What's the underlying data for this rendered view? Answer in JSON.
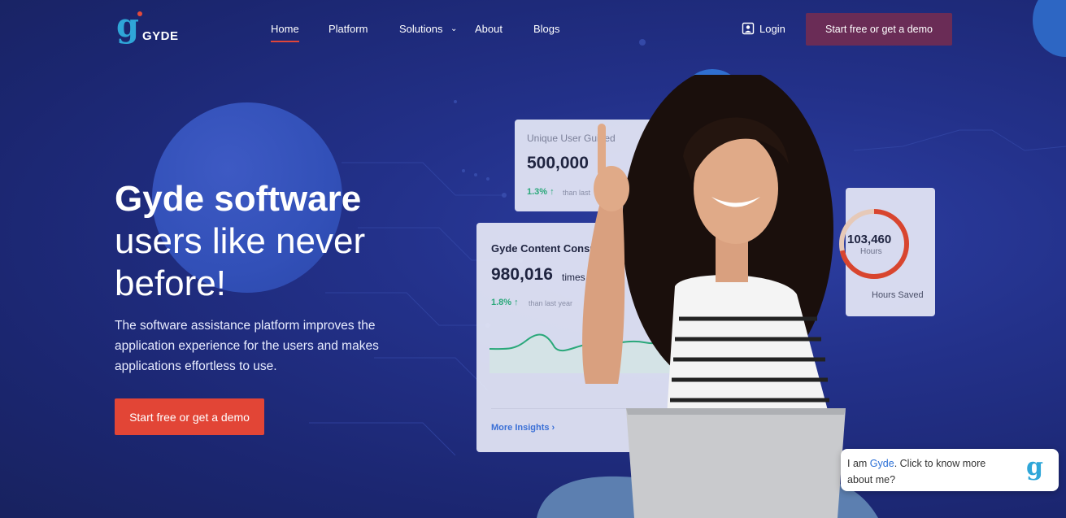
{
  "brand": {
    "logo_letter": "g",
    "logo_text": "GYDE"
  },
  "nav": {
    "items": [
      {
        "label": "Home",
        "active": true
      },
      {
        "label": "Platform"
      },
      {
        "label": "Solutions"
      },
      {
        "label": "About"
      },
      {
        "label": "Blogs"
      }
    ],
    "login_label": "Login",
    "cta_label": "Start free or get a demo"
  },
  "hero": {
    "title_bold": "Gyde software",
    "title_rest": "users like never before!",
    "subtitle": "The software assistance platform improves the application experience for the users and makes applications effortless to use.",
    "cta_label": "Start free or get a demo"
  },
  "cards": {
    "users": {
      "title": "Unique User Guided",
      "value": "500,000",
      "pct": "1.3% ↑",
      "note": "than last"
    },
    "content": {
      "title": "Gyde Content Consumed",
      "value": "980,016",
      "unit": "times",
      "pct": "1.8% ↑",
      "note": "than last year",
      "more": "More Insights ›"
    },
    "hours": {
      "value": "103,460",
      "unit": "Hours",
      "label": "Hours Saved"
    }
  },
  "chat": {
    "prefix": "I am ",
    "name": "Gyde",
    "suffix": ". Click to know more about me?"
  },
  "colors": {
    "bg": "#1f2b78",
    "accent_red": "#e24536",
    "cta_purple": "#6a2c56",
    "green": "#2aa87a",
    "logo_blue": "#2fa6d8"
  }
}
